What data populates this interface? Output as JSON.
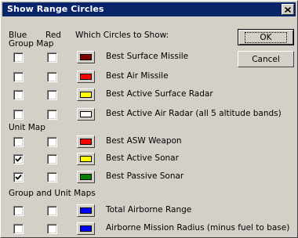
{
  "window": {
    "title": "Show Range Circles"
  },
  "header": {
    "blue": "Blue",
    "red": "Red",
    "which": "Which Circles to Show:"
  },
  "buttons": {
    "ok": "OK",
    "cancel": "Cancel"
  },
  "sections": [
    {
      "label": "Group Map",
      "rows": [
        {
          "label": "Best Surface Missile",
          "blue_checked": false,
          "red_checked": false,
          "color": "#800000"
        },
        {
          "label": "Best Air Missile",
          "blue_checked": false,
          "red_checked": false,
          "color": "#ff0000"
        },
        {
          "label": "Best Active Surface Radar",
          "blue_checked": false,
          "red_checked": false,
          "color": "#ffff00"
        },
        {
          "label": "Best Active Air Radar (all 5 altitude bands)",
          "blue_checked": false,
          "red_checked": false,
          "color": "#ffffff"
        }
      ]
    },
    {
      "label": "Unit Map",
      "rows": [
        {
          "label": "Best ASW Weapon",
          "blue_checked": false,
          "red_checked": false,
          "color": "#ff0000"
        },
        {
          "label": "Best Active Sonar",
          "blue_checked": true,
          "red_checked": false,
          "color": "#ffff00"
        },
        {
          "label": "Best Passive Sonar",
          "blue_checked": true,
          "red_checked": false,
          "color": "#008000"
        }
      ]
    },
    {
      "label": "Group and Unit Maps",
      "rows": [
        {
          "label": "Total Airborne Range",
          "blue_checked": false,
          "red_checked": false,
          "color": "#0000ff"
        },
        {
          "label": "Airborne Mission Radius (minus fuel to base)",
          "blue_checked": false,
          "red_checked": false,
          "color": "#0000ff"
        }
      ]
    }
  ],
  "icons": {
    "close": "close-icon",
    "check": "checkmark-icon"
  }
}
